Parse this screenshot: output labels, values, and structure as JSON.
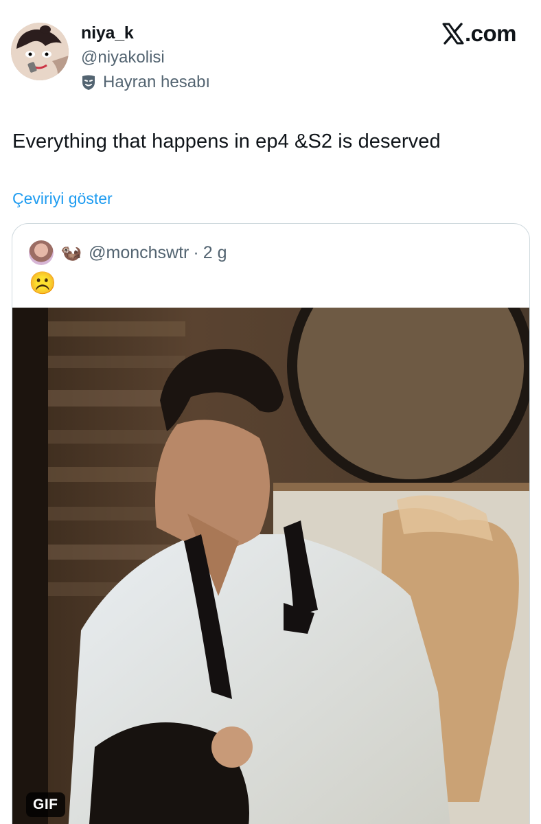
{
  "author": {
    "display_name": "niya_k",
    "handle": "@niyakolisi",
    "badge_icon": "theater-mask-icon",
    "badge_label": "Hayran hesabı"
  },
  "brand": {
    "label": ".com",
    "icon": "x-logo-icon"
  },
  "tweet": {
    "text": "Everything that happens in ep4 &S2 is deserved",
    "translate_link": "Çeviriyi göster"
  },
  "quoted_tweet": {
    "handle": "@monchswtr",
    "separator": "·",
    "time": "2 g",
    "name_emoji": "🦦",
    "text": "☹️",
    "media_badge": "GIF",
    "media_subject": "man-in-white-shirt-untied-bowtie"
  },
  "colors": {
    "secondary_text": "#536471",
    "link": "#1d9bf0",
    "card_border": "#cfd9de"
  }
}
